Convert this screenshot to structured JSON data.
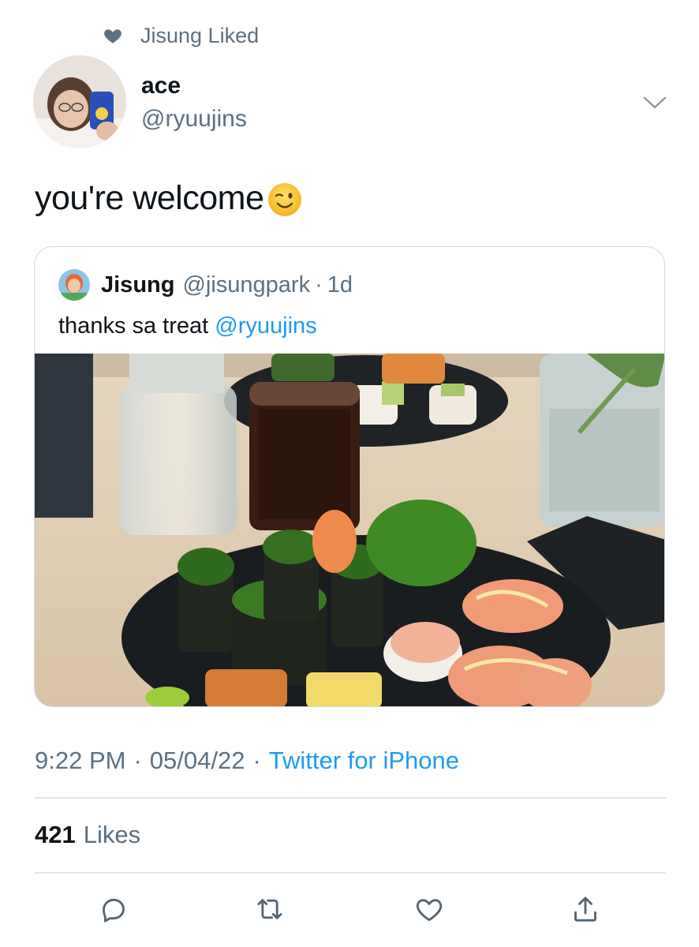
{
  "social_context": {
    "text": "Jisung Liked",
    "icon": "heart-icon"
  },
  "author": {
    "name": "ace",
    "handle": "@ryuujins"
  },
  "tweet": {
    "text": "you're welcome",
    "emoji": "winking-face-emoji"
  },
  "quote": {
    "name": "Jisung",
    "handle": "@jisungpark",
    "separator": "·",
    "age": "1d",
    "text": "thanks sa treat ",
    "mention": "@ryuujins"
  },
  "meta": {
    "time": "9:22 PM",
    "separator": "·",
    "date": "05/04/22",
    "source": "Twitter for iPhone"
  },
  "engagement": {
    "likes_count": "421",
    "likes_label": "Likes"
  },
  "actions": [
    {
      "name": "reply",
      "icon": "reply-icon"
    },
    {
      "name": "retweet",
      "icon": "retweet-icon"
    },
    {
      "name": "like",
      "icon": "like-icon"
    },
    {
      "name": "share",
      "icon": "share-icon"
    }
  ],
  "colors": {
    "accent": "#1d9bf0",
    "secondary_text": "#5b7083",
    "primary_text": "#0f1419",
    "border": "#cfd9de"
  }
}
